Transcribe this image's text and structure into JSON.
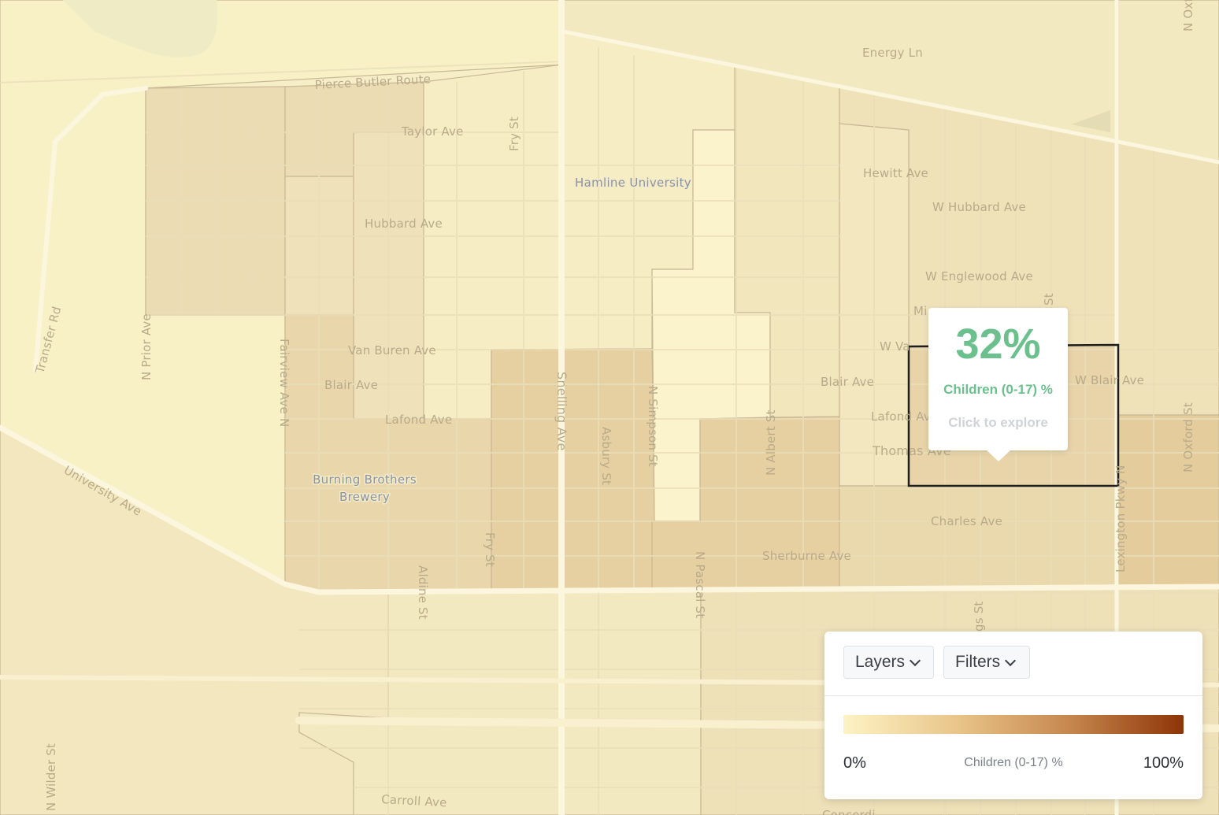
{
  "map": {
    "streets": {
      "energy_ln": "Energy Ln",
      "pierce_butler": "Pierce Butler Route",
      "taylor": "Taylor Ave",
      "fry_north": "Fry St",
      "hubbard": "Hubbard Ave",
      "hewitt": "Hewitt Ave",
      "w_hubbard": "W Hubbard Ave",
      "w_englewood": "W Englewood Ave",
      "minnehaha_partial": "Mi",
      "w_vanburen_partial": "W Va",
      "w_blair": "W Blair Ave",
      "van_buren": "Van Buren Ave",
      "blair_west": "Blair Ave",
      "blair_mid": "Blair Ave",
      "lafond_west": "Lafond Ave",
      "lafond_east": "Lafond Av",
      "thomas": "Thomas Ave",
      "charles": "Charles Ave",
      "sherburne": "Sherburne Ave",
      "university": "University Ave",
      "transfer": "Transfer Rd",
      "n_prior": "N Prior Ave",
      "fairview": "Fairview Ave N",
      "snelling": "Snelling Ave",
      "asbury": "Asbury St",
      "n_simpson": "N Simpson St",
      "n_albert": "N Albert St",
      "n_pascal": "N Pascal St",
      "fry_south": "Fry St",
      "aldine": "Aldine St",
      "lexington": "Lexington Pkwy N",
      "n_oxford": "N Oxford St",
      "n_oxford_top": "N Oxf",
      "st_partial": "St",
      "hamline_st_partial": "gs St",
      "n_wilder": "N Wilder St",
      "carroll": "Carroll Ave",
      "concordia_partial": "Concordi"
    },
    "pois": {
      "hamline": "Hamline University",
      "brewery_line1": "Burning Brothers",
      "brewery_line2": "Brewery"
    }
  },
  "tooltip": {
    "value": "32%",
    "label": "Children (0-17) %",
    "cta": "Click to explore"
  },
  "panel": {
    "layers_label": "Layers",
    "filters_label": "Filters",
    "legend": {
      "min": "0%",
      "max": "100%",
      "title": "Children (0-17) %",
      "colors": [
        "#fdf3c4",
        "#e9c58a",
        "#c5874e",
        "#8e3406"
      ]
    }
  },
  "colors": {
    "base": "#f6eec7",
    "tract_light": "#f8f1c6",
    "tract_low": "#f2e6be",
    "tract_mid": "#ecddb5",
    "tract_high": "#e6d0a4",
    "selection": "#1e1e1e",
    "accent": "#6cc08e"
  }
}
